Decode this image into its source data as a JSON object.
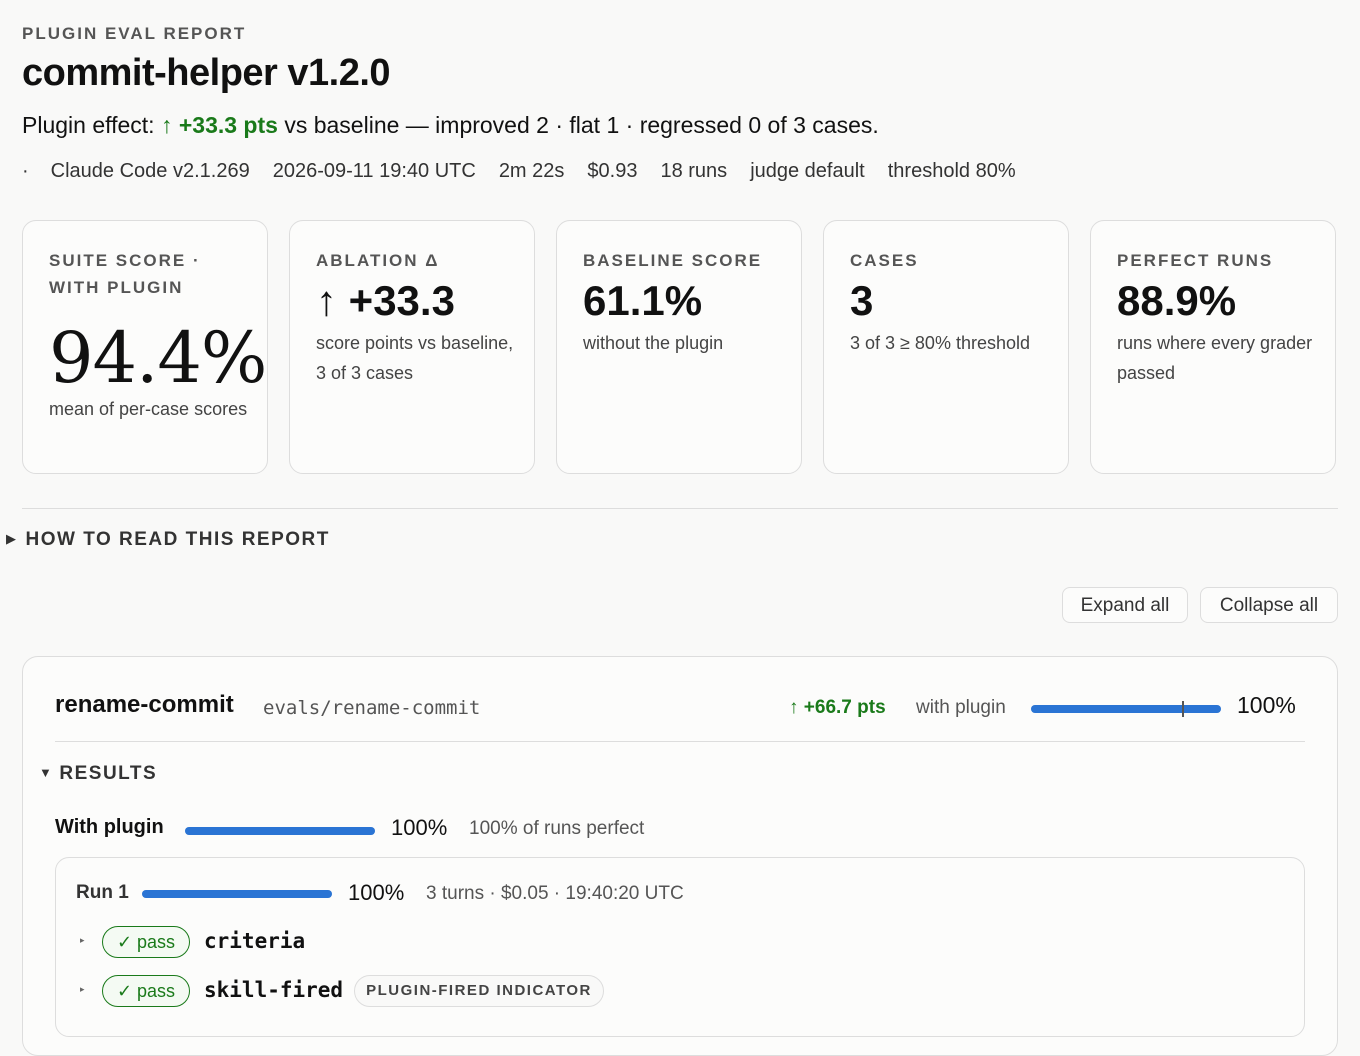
{
  "header": {
    "eyebrow": "PLUGIN EVAL REPORT",
    "title": "commit-helper v1.2.0",
    "effect_prefix": "Plugin effect:",
    "effect_arrow": "↑",
    "effect_value": "+33.3 pts",
    "effect_suffix": "vs baseline — improved 2 · flat 1 · regressed 0 of 3 cases."
  },
  "meta": {
    "bullet": "·",
    "client": "Claude Code v2.1.269",
    "timestamp": "2026-09-11 19:40 UTC",
    "duration": "2m 22s",
    "cost": "$0.93",
    "runs": "18 runs",
    "judge": "judge default",
    "threshold": "threshold 80%"
  },
  "cards": {
    "suite": {
      "label": "SUITE SCORE · WITH PLUGIN",
      "value": "94.4%",
      "sub": "mean of per-case scores"
    },
    "ablation": {
      "label": "ABLATION Δ",
      "value": "↑ +33.3",
      "sub": "score points vs baseline, 3 of 3 cases"
    },
    "baseline": {
      "label": "BASELINE SCORE",
      "value": "61.1%",
      "sub": "without the plugin"
    },
    "cases": {
      "label": "CASES",
      "value": "3",
      "sub": "3 of 3 ≥ 80% threshold"
    },
    "perfect": {
      "label": "PERFECT RUNS",
      "value": "88.9%",
      "sub": "runs where every grader passed"
    }
  },
  "howto": {
    "tri": "▶",
    "label": "HOW TO READ THIS REPORT"
  },
  "controls": {
    "expand_all": "Expand all",
    "collapse_all": "Collapse all"
  },
  "case": {
    "name": "rename-commit",
    "path": "evals/rename-commit",
    "delta": "↑ +66.7 pts",
    "with_label": "with plugin",
    "score_fraction": 1.0,
    "baseline_marker_fraction": 0.8,
    "score_pct": "100%",
    "results_tri": "▼",
    "results_label": "RESULTS",
    "with_plugin": {
      "label": "With plugin",
      "fraction": 1.0,
      "pct": "100%",
      "sub": "100% of runs perfect"
    },
    "run": {
      "label": "Run 1",
      "fraction": 1.0,
      "pct": "100%",
      "sub": "3 turns · $0.05 · 19:40:20 UTC",
      "graders": [
        {
          "caret": "▸",
          "status": "✓ pass",
          "name": "criteria",
          "tag": ""
        },
        {
          "caret": "▸",
          "status": "✓ pass",
          "name": "skill-fired",
          "tag": "PLUGIN-FIRED INDICATOR"
        }
      ]
    }
  },
  "colors": {
    "accent_blue": "#2a74d4",
    "pass_green": "#1a7a1a",
    "border": "#dddddd"
  }
}
